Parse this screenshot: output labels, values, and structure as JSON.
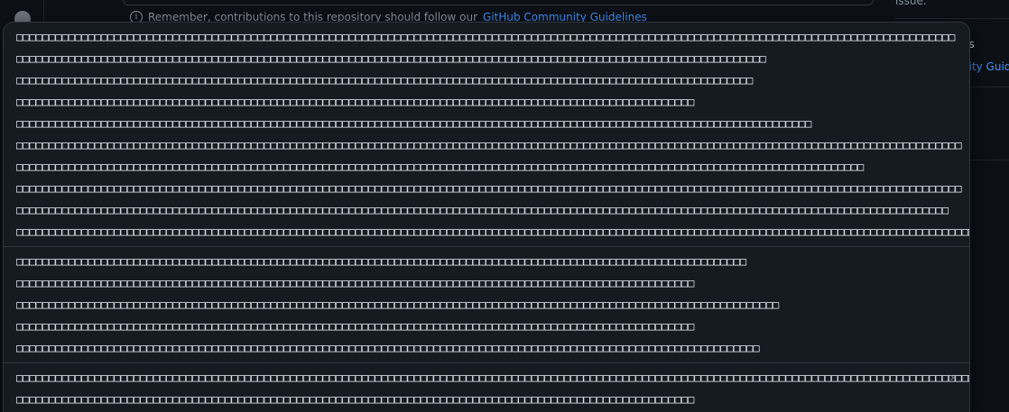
{
  "reminder": {
    "prefix": "Remember, contributions to this repository should follow our",
    "link": "GitHub Community Guidelines"
  },
  "sidebar": {
    "issue_label": "issue.",
    "frag_1": "es",
    "frag_2": "nity Guid"
  },
  "menu": {
    "groups": [
      [
        "□□□□□□□□□□□□□□□□□□□□□□□□□□□□□□□□□□□□□□□□□□□□□□□□□□□□□□□□□□□□□□□□□□□□□□□□□□□□□□□□□□□□□□□□□□□□□□□□□□□□□□□□□□□□□□□□□□□□□□□□□□□□□□□□□□□□□□□□□□□□□□□□",
        "□□□□□□□□□□□□□□□□□□□□□□□□□□□□□□□□□□□□□□□□□□□□□□□□□□□□□□□□□□□□□□□□□□□□□□□□□□□□□□□□□□□□□□□□□□□□□□□□□□□□□□□□□□□□□□□□□□□",
        "□□□□□□□□□□□□□□□□□□□□□□□□□□□□□□□□□□□□□□□□□□□□□□□□□□□□□□□□□□□□□□□□□□□□□□□□□□□□□□□□□□□□□□□□□□□□□□□□□□□□□□□□□□□□□□□□□",
        "□□□□□□□□□□□□□□□□□□□□□□□□□□□□□□□□□□□□□□□□□□□□□□□□□□□□□□□□□□□□□□□□□□□□□□□□□□□□□□□□□□□□□□□□□□□□□□□□□□□□□□□□",
        "□□□□□□□□□□□□□□□□□□□□□□□□□□□□□□□□□□□□□□□□□□□□□□□□□□□□□□□□□□□□□□□□□□□□□□□□□□□□□□□□□□□□□□□□□□□□□□□□□□□□□□□□□□□□□□□□□□□□□□□□□□",
        "□□□□□□□□□□□□□□□□□□□□□□□□□□□□□□□□□□□□□□□□□□□□□□□□□□□□□□□□□□□□□□□□□□□□□□□□□□□□□□□□□□□□□□□□□□□□□□□□□□□□□□□□□□□□□□□□□□□□□□□□□□□□□□□□□□□□□□□□□□□□□□□□□",
        "□□□□□□□□□□□□□□□□□□□□□□□□□□□□□□□□□□□□□□□□□□□□□□□□□□□□□□□□□□□□□□□□□□□□□□□□□□□□□□□□□□□□□□□□□□□□□□□□□□□□□□□□□□□□□□□□□□□□□□□□□□□□□□□□□□",
        "□□□□□□□□□□□□□□□□□□□□□□□□□□□□□□□□□□□□□□□□□□□□□□□□□□□□□□□□□□□□□□□□□□□□□□□□□□□□□□□□□□□□□□□□□□□□□□□□□□□□□□□□□□□□□□□□□□□□□□□□□□□□□□□□□□□□□□□□□□□□□□□□□",
        "□□□□□□□□□□□□□□□□□□□□□□□□□□□□□□□□□□□□□□□□□□□□□□□□□□□□□□□□□□□□□□□□□□□□□□□□□□□□□□□□□□□□□□□□□□□□□□□□□□□□□□□□□□□□□□□□□□□□□□□□□□□□□□□□□□□□□□□□□□□□□□□",
        "□□□□□□□□□□□□□□□□□□□□□□□□□□□□□□□□□□□□□□□□□□□□□□□□□□□□□□□□□□□□□□□□□□□□□□□□□□□□□□□□□□□□□□□□□□□□□□□□□□□□□□□□□□□□□□□□□□□□□□□□□□□□□□□□□□□□□□□□□□□□□□□□□□□□□□□□□□□□□□□□□□□□□□□□"
      ],
      [
        "□□□□□□□□□□□□□□□□□□□□□□□□□□□□□□□□□□□□□□□□□□□□□□□□□□□□□□□□□□□□□□□□□□□□□□□□□□□□□□□□□□□□□□□□□□□□□□□□□□□□□□□□□□□□□□□□",
        "□□□□□□□□□□□□□□□□□□□□□□□□□□□□□□□□□□□□□□□□□□□□□□□□□□□□□□□□□□□□□□□□□□□□□□□□□□□□□□□□□□□□□□□□□□□□□□□□□□□□□□□□",
        "□□□□□□□□□□□□□□□□□□□□□□□□□□□□□□□□□□□□□□□□□□□□□□□□□□□□□□□□□□□□□□□□□□□□□□□□□□□□□□□□□□□□□□□□□□□□□□□□□□□□□□□□□□□□□□□□□□□□□",
        "□□□□□□□□□□□□□□□□□□□□□□□□□□□□□□□□□□□□□□□□□□□□□□□□□□□□□□□□□□□□□□□□□□□□□□□□□□□□□□□□□□□□□□□□□□□□□□□□□□□□□□□□",
        "□□□□□□□□□□□□□□□□□□□□□□□□□□□□□□□□□□□□□□□□□□□□□□□□□□□□□□□□□□□□□□□□□□□□□□□□□□□□□□□□□□□□□□□□□□□□□□□□□□□□□□□□□□□□□□□□□□"
      ],
      [
        "□□□□□□□□□□□□□□□□□□□□□□□□□□□□□□□□□□□□□□□□□□□□□□□□□□□□□□□□□□□□□□□□□□□□□□□□□□□□□□□□□□□□□□□□□□□□□□□□□□□□□□□□□□□□□□□□□□□□□□□□□□□□□□□□□□□□□□□□□□□□□□□□□□□□□□□□□□□□□□□□□",
        "□□□□□□□□□□□□□□□□□□□□□□□□□□□□□□□□□□□□□□□□□□□□□□□□□□□□□□□□□□□□□□□□□□□□□□□□□□□□□□□□□□□□□□□□□□□□□□□□□□□□□□□□"
      ]
    ],
    "chevron": "›"
  }
}
